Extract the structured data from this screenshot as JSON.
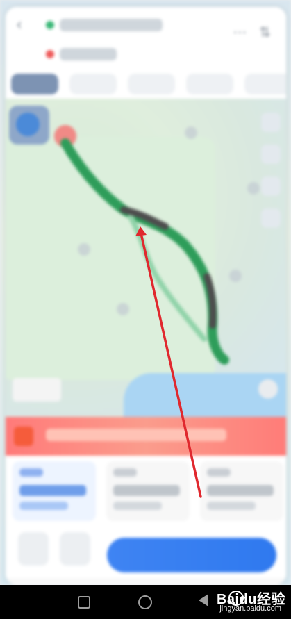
{
  "title_bar": {
    "start_place": "",
    "end_place": ""
  },
  "tabs": [
    {
      "label": ""
    },
    {
      "label": ""
    },
    {
      "label": ""
    },
    {
      "label": ""
    },
    {
      "label": ""
    }
  ],
  "map": {
    "bottom_left_label": "",
    "has_blue_region": true
  },
  "banner": {
    "text": ""
  },
  "plans": [
    {
      "title": "",
      "time": "",
      "distance": ""
    },
    {
      "title": "",
      "time": "",
      "distance": ""
    },
    {
      "title": "",
      "time": "",
      "distance": ""
    }
  ],
  "actions": {
    "start_button_label": ""
  },
  "watermark": {
    "brand": "Baidu经验",
    "domain": "jingyan.baidu.com"
  },
  "colors": {
    "arrow": "#e0282e",
    "route_green": "#2e9d5a",
    "start_button": "#2f79ef"
  },
  "icons": [
    "back-icon",
    "more-icon",
    "location-icon",
    "layer-icon",
    "home-icon",
    "back-triangle-icon"
  ]
}
